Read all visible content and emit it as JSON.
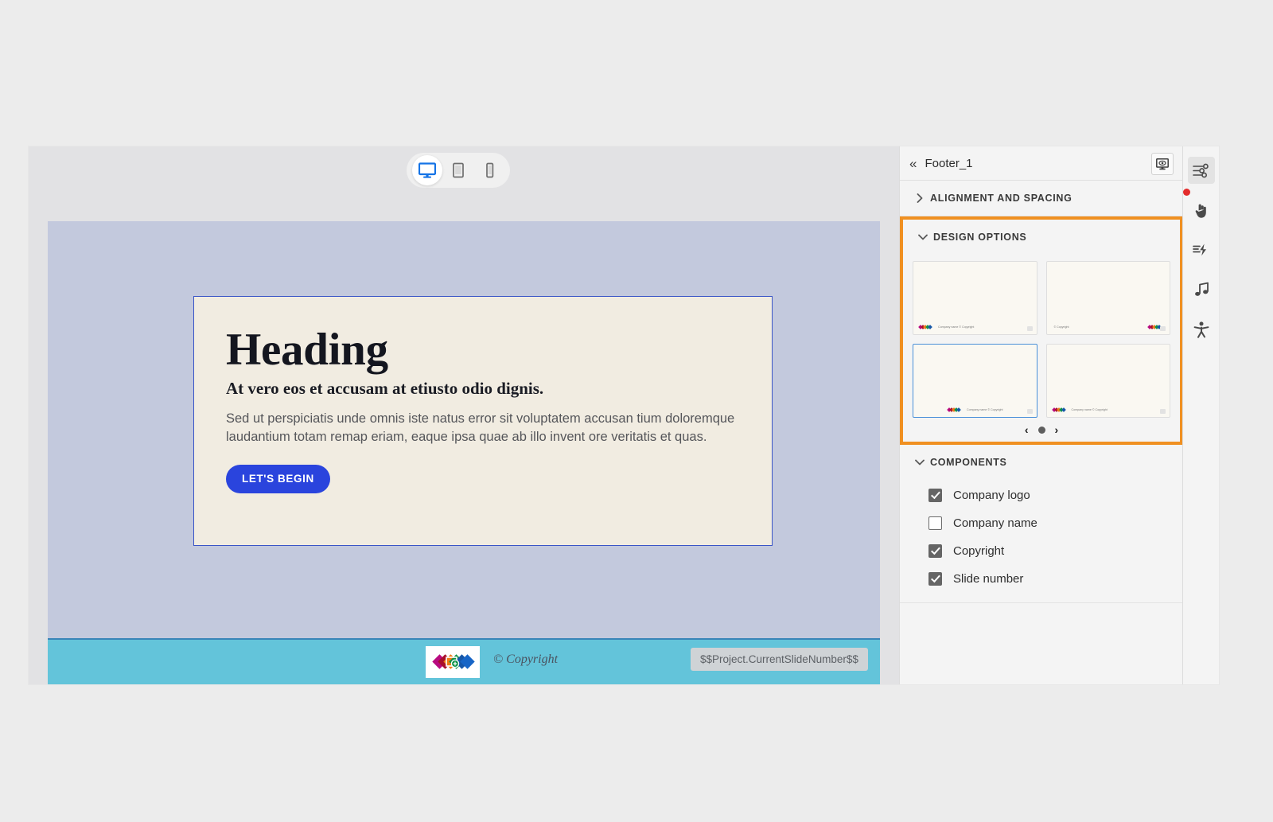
{
  "stage": {
    "device_toolbar": {
      "options": [
        {
          "name": "desktop",
          "icon": "desktop-icon",
          "selected": true
        },
        {
          "name": "tablet",
          "icon": "tablet-icon",
          "selected": false
        },
        {
          "name": "mobile",
          "icon": "mobile-icon",
          "selected": false
        }
      ]
    },
    "slide": {
      "heading": "Heading",
      "subheading": "At vero eos et accusam at etiusto odio dignis.",
      "body": "Sed ut perspiciatis unde omnis iste natus error sit voluptatem accusan tium doloremque laudantium totam remap eriam, eaque ipsa quae ab illo invent ore veritatis et quas.",
      "cta_label": "LET'S BEGIN",
      "footer": {
        "logo_icon": "company-logo-icon",
        "copyright": "© Copyright",
        "slide_number_token": "$$Project.CurrentSlideNumber$$"
      }
    }
  },
  "panel": {
    "title": "Footer_1",
    "back_icon": "double-chevron-left-icon",
    "preview_icon": "preview-monitor-icon",
    "sections": [
      {
        "label": "ALIGNMENT AND SPACING",
        "expanded": false,
        "chevron": "chevron-right-icon"
      },
      {
        "label": "DESIGN OPTIONS",
        "expanded": true,
        "chevron": "chevron-down-icon",
        "highlighted": true
      },
      {
        "label": "COMPONENTS",
        "expanded": true,
        "chevron": "chevron-down-icon"
      }
    ],
    "design_options": {
      "thumbnails": [
        {
          "id": "option-1",
          "selected": false,
          "logo_align": "left",
          "caption": "Company name  © Copyright"
        },
        {
          "id": "option-2",
          "selected": false,
          "logo_align": "right",
          "caption": "© Copyright"
        },
        {
          "id": "option-3",
          "selected": true,
          "logo_align": "center",
          "caption": "Company name  © Copyright"
        },
        {
          "id": "option-4",
          "selected": false,
          "logo_align": "left",
          "caption": "Company name  © Copyright"
        }
      ],
      "carousel": {
        "prev_icon": "chevron-left-icon",
        "next_icon": "chevron-right-icon",
        "page_count": 1,
        "current_page": 1
      }
    },
    "components": [
      {
        "label": "Company logo",
        "checked": true
      },
      {
        "label": "Company name",
        "checked": false
      },
      {
        "label": "Copyright",
        "checked": true
      },
      {
        "label": "Slide number",
        "checked": true
      }
    ]
  },
  "rail": {
    "items": [
      {
        "icon": "properties-sliders-icon",
        "active": true,
        "badge": false
      },
      {
        "icon": "interactions-hand-icon",
        "active": false,
        "badge": true
      },
      {
        "icon": "animation-lightning-icon",
        "active": false,
        "badge": false
      },
      {
        "icon": "audio-music-note-icon",
        "active": false,
        "badge": false
      },
      {
        "icon": "accessibility-person-icon",
        "active": false,
        "badge": false
      }
    ]
  },
  "colors": {
    "highlight": "#f09021",
    "accent_blue": "#2a44dd",
    "footer_band": "#63c4da",
    "slide_bg": "#c3c9dd",
    "card_bg": "#f1ece1",
    "selected_thumb_border": "#4a90d9",
    "badge_red": "#e32c2c"
  }
}
